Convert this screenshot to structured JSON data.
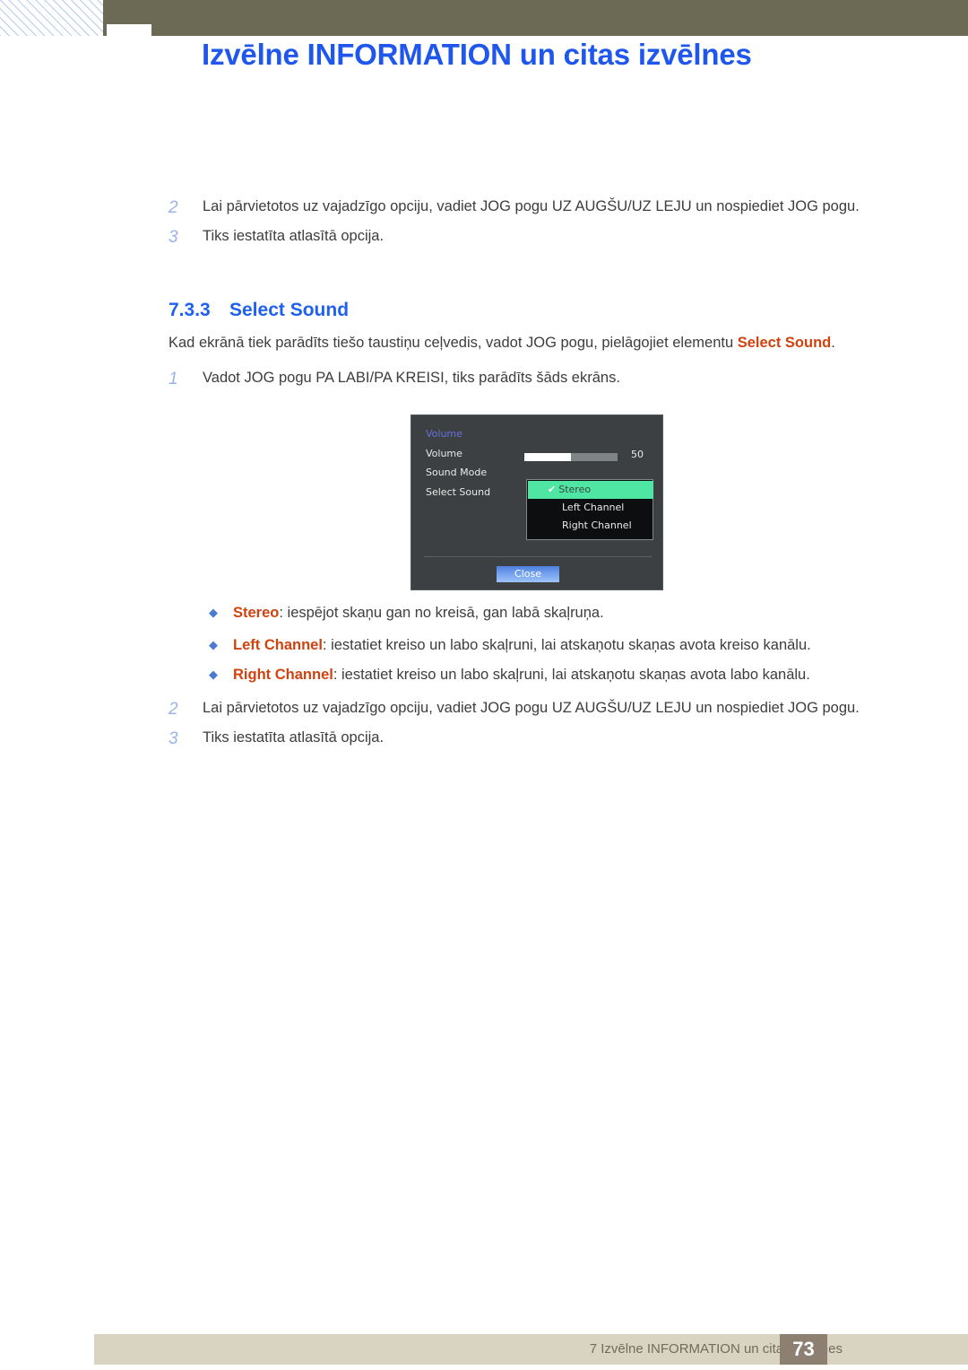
{
  "header": {
    "title": "Izvēlne INFORMATION un citas izvēlnes"
  },
  "top_steps": [
    {
      "num": "2",
      "text": "Lai pārvietotos uz vajadzīgo opciju, vadiet JOG pogu UZ AUGŠU/UZ LEJU un nospiediet JOG pogu."
    },
    {
      "num": "3",
      "text": "Tiks iestatīta atlasītā opcija."
    }
  ],
  "section": {
    "number": "7.3.3",
    "title": "Select Sound"
  },
  "intro": {
    "before": "Kad ekrānā tiek parādīts tiešo taustiņu ceļvedis, vadot JOG pogu, pielāgojiet elementu ",
    "keyword": "Select Sound",
    "after": "."
  },
  "step1": {
    "num": "1",
    "text": "Vadot JOG pogu PA LABI/PA KREISI, tiks parādīts šāds ekrāns."
  },
  "osd": {
    "title": "Volume",
    "labels": [
      "Volume",
      "Sound Mode",
      "Select Sound"
    ],
    "slider_value": "50",
    "slider_percent": 50,
    "options": [
      {
        "label": "Stereo",
        "selected": true,
        "check": "✔"
      },
      {
        "label": "Left Channel",
        "selected": false
      },
      {
        "label": "Right Channel",
        "selected": false
      }
    ],
    "close_label": "Close",
    "colors": {
      "panel_bg": "#3d4042",
      "highlight": "#4ee6a2",
      "title_blue": "#6472dc",
      "close_blue": "#7ba7f0"
    }
  },
  "bullets": [
    {
      "marker": "◆",
      "keyword": "Stereo",
      "text": ": iespējot skaņu gan no kreisā, gan labā skaļruņa."
    },
    {
      "marker": "◆",
      "keyword": "Left Channel",
      "text": ": iestatiet kreiso un labo skaļruni, lai atskaņotu skaņas avota kreiso kanālu."
    },
    {
      "marker": "◆",
      "keyword": "Right Channel",
      "text": ": iestatiet kreiso un labo skaļruni, lai atskaņotu skaņas avota labo kanālu."
    }
  ],
  "bottom_steps": [
    {
      "num": "2",
      "text": "Lai pārvietotos uz vajadzīgo opciju, vadiet JOG pogu UZ AUGŠU/UZ LEJU un nospiediet JOG pogu."
    },
    {
      "num": "3",
      "text": "Tiks iestatīta atlasītā opcija."
    }
  ],
  "footer": {
    "text": "7 Izvēlne INFORMATION un citas izvēlnes",
    "page": "73"
  }
}
